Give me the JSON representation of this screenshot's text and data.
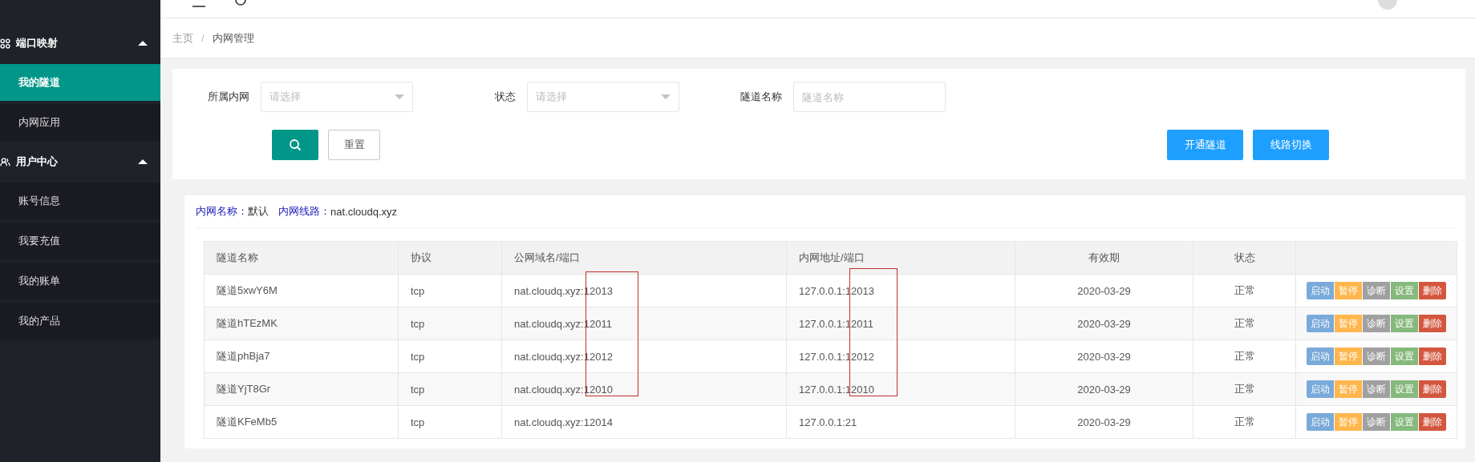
{
  "sidebar": {
    "groups": [
      {
        "title": "端口映射",
        "expanded": true,
        "items": [
          {
            "label": "我的隧道",
            "selected": true
          },
          {
            "label": "内网应用",
            "selected": false
          }
        ]
      },
      {
        "title": "用户中心",
        "expanded": true,
        "items": [
          {
            "label": "账号信息",
            "selected": false
          },
          {
            "label": "我要充值",
            "selected": false
          },
          {
            "label": "我的账单",
            "selected": false
          },
          {
            "label": "我的产品",
            "selected": false
          }
        ]
      }
    ]
  },
  "breadcrumb": {
    "separator": "/",
    "items": [
      "主页",
      "内网管理"
    ]
  },
  "filters": [
    {
      "kind": "select",
      "label": "所属内网",
      "placeholder": "请选择"
    },
    {
      "kind": "select",
      "label": "状态",
      "placeholder": "请选择"
    },
    {
      "kind": "input",
      "label": "隧道名称",
      "placeholder": "隧道名称"
    }
  ],
  "reset_button": "重置",
  "right_buttons": [
    "开通隧道",
    "线路切换"
  ],
  "info": [
    {
      "label": "内网名称：",
      "value": "默认"
    },
    {
      "label": "内网线路：",
      "value": "nat.cloudq.xyz"
    }
  ],
  "table": {
    "columns": [
      "隧道名称",
      "协议",
      "公网域名/端口",
      "内网地址/端口",
      "有效期",
      "状态"
    ],
    "rows": [
      {
        "cells": [
          "隧道5xwY6M",
          "tcp",
          "nat.cloudq.xyz:12013",
          "127.0.0.1:12013",
          "2020-03-29",
          "正常"
        ],
        "actions": [
          {
            "label": "启动",
            "color": "#7aaad9"
          },
          {
            "label": "暂停",
            "color": "#ffb64d"
          },
          {
            "label": "诊断",
            "color": "#a0a0a0"
          },
          {
            "label": "设置",
            "color": "#86b97c"
          },
          {
            "label": "删除",
            "color": "#d3573f"
          }
        ]
      },
      {
        "cells": [
          "隧道hTEzMK",
          "tcp",
          "nat.cloudq.xyz:12011",
          "127.0.0.1:12011",
          "2020-03-29",
          "正常"
        ],
        "actions": [
          {
            "label": "启动",
            "color": "#7aaad9"
          },
          {
            "label": "暂停",
            "color": "#ffb64d"
          },
          {
            "label": "诊断",
            "color": "#a0a0a0"
          },
          {
            "label": "设置",
            "color": "#86b97c"
          },
          {
            "label": "删除",
            "color": "#d3573f"
          }
        ]
      },
      {
        "cells": [
          "隧道phBja7",
          "tcp",
          "nat.cloudq.xyz:12012",
          "127.0.0.1:12012",
          "2020-03-29",
          "正常"
        ],
        "actions": [
          {
            "label": "启动",
            "color": "#7aaad9"
          },
          {
            "label": "暂停",
            "color": "#ffb64d"
          },
          {
            "label": "诊断",
            "color": "#a0a0a0"
          },
          {
            "label": "设置",
            "color": "#86b97c"
          },
          {
            "label": "删除",
            "color": "#d3573f"
          }
        ]
      },
      {
        "cells": [
          "隧道YjT8Gr",
          "tcp",
          "nat.cloudq.xyz:12010",
          "127.0.0.1:12010",
          "2020-03-29",
          "正常"
        ],
        "actions": [
          {
            "label": "启动",
            "color": "#7aaad9"
          },
          {
            "label": "暂停",
            "color": "#ffb64d"
          },
          {
            "label": "诊断",
            "color": "#a0a0a0"
          },
          {
            "label": "设置",
            "color": "#86b97c"
          },
          {
            "label": "删除",
            "color": "#d3573f"
          }
        ]
      },
      {
        "cells": [
          "隧道KFeMb5",
          "tcp",
          "nat.cloudq.xyz:12014",
          "127.0.0.1:21",
          "2020-03-29",
          "正常"
        ],
        "actions": [
          {
            "label": "启动",
            "color": "#7aaad9"
          },
          {
            "label": "暂停",
            "color": "#ffb64d"
          },
          {
            "label": "诊断",
            "color": "#a0a0a0"
          },
          {
            "label": "设置",
            "color": "#86b97c"
          },
          {
            "label": "删除",
            "color": "#d3573f"
          }
        ]
      }
    ]
  }
}
